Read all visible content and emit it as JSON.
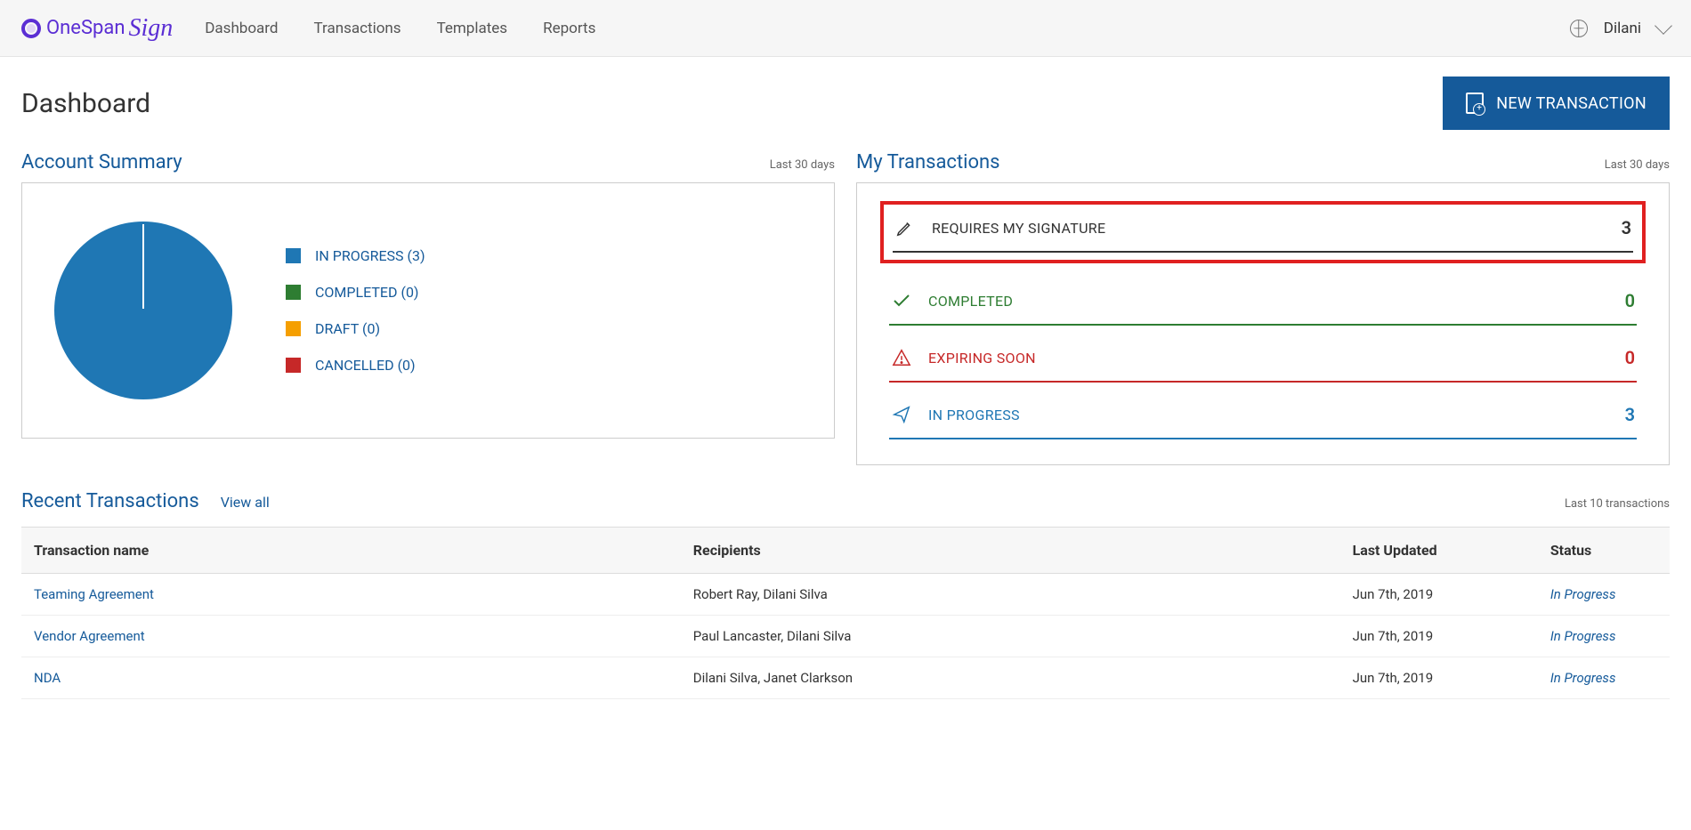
{
  "brand": {
    "part1": "OneSpan",
    "part2": "Sign"
  },
  "nav": [
    "Dashboard",
    "Transactions",
    "Templates",
    "Reports"
  ],
  "user": {
    "name": "Dilani"
  },
  "page": {
    "title": "Dashboard"
  },
  "new_transaction_label": "NEW TRANSACTION",
  "account_summary": {
    "title": "Account Summary",
    "range_label": "Last 30 days",
    "legend": [
      {
        "label": "IN PROGRESS (3)",
        "color": "#1f77b4"
      },
      {
        "label": "COMPLETED (0)",
        "color": "#2e7d32"
      },
      {
        "label": "DRAFT (0)",
        "color": "#f59f00"
      },
      {
        "label": "CANCELLED (0)",
        "color": "#c62828"
      }
    ]
  },
  "chart_data": {
    "type": "pie",
    "title": "Account Summary",
    "categories": [
      "IN PROGRESS",
      "COMPLETED",
      "DRAFT",
      "CANCELLED"
    ],
    "values": [
      3,
      0,
      0,
      0
    ],
    "colors": [
      "#1f77b4",
      "#2e7d32",
      "#f59f00",
      "#c62828"
    ]
  },
  "my_transactions": {
    "title": "My Transactions",
    "range_label": "Last 30 days",
    "items": [
      {
        "label": "REQUIRES MY SIGNATURE",
        "count": "3",
        "color": "#333333",
        "highlighted": true
      },
      {
        "label": "COMPLETED",
        "count": "0",
        "color": "#2e7d32"
      },
      {
        "label": "EXPIRING SOON",
        "count": "0",
        "color": "#c62828"
      },
      {
        "label": "IN PROGRESS",
        "count": "3",
        "color": "#1f77b4"
      }
    ]
  },
  "recent": {
    "title": "Recent Transactions",
    "view_all_label": "View all",
    "sub_label": "Last 10 transactions",
    "columns": [
      "Transaction name",
      "Recipients",
      "Last Updated",
      "Status"
    ],
    "rows": [
      {
        "name": "Teaming Agreement",
        "recipients": "Robert Ray, Dilani Silva",
        "updated": "Jun 7th, 2019",
        "status": "In Progress"
      },
      {
        "name": "Vendor Agreement",
        "recipients": "Paul Lancaster, Dilani Silva",
        "updated": "Jun 7th, 2019",
        "status": "In Progress"
      },
      {
        "name": "NDA",
        "recipients": "Dilani Silva, Janet Clarkson",
        "updated": "Jun 7th, 2019",
        "status": "In Progress"
      }
    ]
  }
}
